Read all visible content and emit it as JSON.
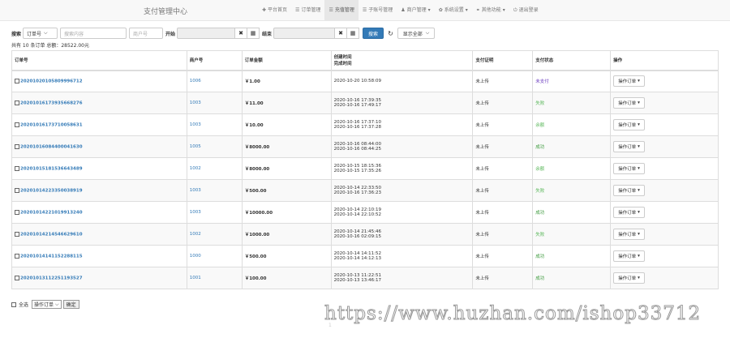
{
  "header": {
    "brand": "支付管理中心",
    "menu": [
      {
        "label": "平台首页",
        "icon": "home-icon",
        "glyph": "✚"
      },
      {
        "label": "订单管理",
        "icon": "list-icon",
        "glyph": "☰"
      },
      {
        "label": "充值管理",
        "icon": "list-icon",
        "glyph": "☰",
        "active": true
      },
      {
        "label": "子账号管理",
        "icon": "list-icon",
        "glyph": "☰"
      },
      {
        "label": "商户管理",
        "icon": "user-icon",
        "glyph": "♟",
        "dropdown": true
      },
      {
        "label": "系统设置",
        "icon": "gear-icon",
        "glyph": "✿",
        "dropdown": true
      },
      {
        "label": "其他功能",
        "icon": "link-icon",
        "glyph": "⚭",
        "dropdown": true
      },
      {
        "label": "退出登录",
        "icon": "power-icon",
        "glyph": "⏻"
      }
    ]
  },
  "search": {
    "label": "搜索",
    "type_select": "订单号",
    "keyword_placeholder": "搜索内容",
    "merchant_placeholder": "商户号",
    "start_label": "开始",
    "end_label": "结束",
    "search_button": "搜索",
    "show_select": "显示全部"
  },
  "summary": "共有 10 条订单 总额：28522.00元",
  "table": {
    "headers": {
      "order_no": "订单号",
      "merchant": "商户号",
      "amount": "订单金额",
      "time_line1": "创建时间",
      "time_line2": "完成时间",
      "notify": "支付证明",
      "status": "支付状态",
      "op": "操作"
    },
    "rows": [
      {
        "order_no": "20201020105809996712",
        "merchant": "1006",
        "amount": "￥1.00",
        "created": "2020-10-20 10:58:09",
        "completed": "",
        "notify": "未上传",
        "status": "未支付",
        "status_class": "st-unpaid",
        "op": "操作订单"
      },
      {
        "order_no": "20201016173935668276",
        "merchant": "1003",
        "amount": "￥11.00",
        "created": "2020-10-16 17:39:35",
        "completed": "2020-10-16 17:49:17",
        "notify": "未上传",
        "status": "失败",
        "status_class": "st-fail",
        "op": "操作订单"
      },
      {
        "order_no": "20201016173710058631",
        "merchant": "1003",
        "amount": "￥10.00",
        "created": "2020-10-16 17:37:10",
        "completed": "2020-10-16 17:37:28",
        "notify": "未上传",
        "status": "余额",
        "status_class": "st-late",
        "op": "操作订单"
      },
      {
        "order_no": "20201016084400041630",
        "merchant": "1005",
        "amount": "￥8000.00",
        "created": "2020-10-16 08:44:00",
        "completed": "2020-10-16 08:44:25",
        "notify": "未上传",
        "status": "成功",
        "status_class": "st-ok",
        "op": "操作订单"
      },
      {
        "order_no": "20201015181536643489",
        "merchant": "1002",
        "amount": "￥8000.00",
        "created": "2020-10-15 18:15:36",
        "completed": "2020-10-15 17:35:26",
        "notify": "未上传",
        "status": "余额",
        "status_class": "st-late",
        "op": "操作订单"
      },
      {
        "order_no": "20201014223350038919",
        "merchant": "1003",
        "amount": "￥500.00",
        "created": "2020-10-14 22:33:50",
        "completed": "2020-10-16 17:36:23",
        "notify": "未上传",
        "status": "失败",
        "status_class": "st-fail",
        "op": "操作订单"
      },
      {
        "order_no": "20201014221019913240",
        "merchant": "1003",
        "amount": "￥10000.00",
        "created": "2020-10-14 22:10:19",
        "completed": "2020-10-14 22:10:52",
        "notify": "未上传",
        "status": "成功",
        "status_class": "st-ok",
        "op": "操作订单"
      },
      {
        "order_no": "20201014214546629610",
        "merchant": "1002",
        "amount": "￥1000.00",
        "created": "2020-10-14 21:45:46",
        "completed": "2020-10-16 02:09:15",
        "notify": "未上传",
        "status": "失败",
        "status_class": "st-fail",
        "op": "操作订单"
      },
      {
        "order_no": "20201014141152288115",
        "merchant": "1000",
        "amount": "￥500.00",
        "created": "2020-10-14 14:11:52",
        "completed": "2020-10-14 14:12:13",
        "notify": "未上传",
        "status": "成功",
        "status_class": "st-ok",
        "op": "操作订单"
      },
      {
        "order_no": "20201013112251193527",
        "merchant": "1001",
        "amount": "￥100.00",
        "created": "2020-10-13 11:22:51",
        "completed": "2020-10-13 13:46:17",
        "notify": "未上传",
        "status": "成功",
        "status_class": "st-ok",
        "op": "操作订单"
      }
    ]
  },
  "footer": {
    "select_all": "全选",
    "bulk_select": "操作订单",
    "confirm": "确定",
    "pager": "1"
  },
  "watermark": "https://www.huzhan.com/ishop33712",
  "colors": {
    "primary": "#337ab7",
    "success": "#3c9a3c",
    "unpaid": "#6f42c1"
  }
}
